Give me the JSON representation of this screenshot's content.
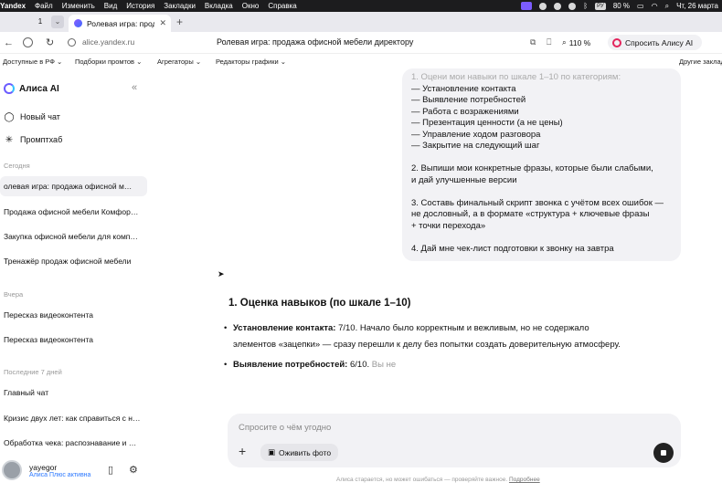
{
  "menubar": {
    "app": "Yandex",
    "items": [
      "Файл",
      "Изменить",
      "Вид",
      "История",
      "Закладки",
      "Вкладка",
      "Окно",
      "Справка"
    ],
    "battery": "80 %",
    "datetime": "Чт, 26 марта",
    "kbd": "РУ"
  },
  "tabs": {
    "count": "1",
    "active_title": "Ролевая игра: продаж"
  },
  "address": {
    "url": "alice.yandex.ru",
    "page_title": "Ролевая игра: продажа офисной мебели директору",
    "zoom": "110 %",
    "alice_button": "Спросить Алису AI"
  },
  "bookmarks": [
    "Доступные в РФ",
    "Подборки промтов",
    "Агрегаторы",
    "Редакторы графики",
    "Другие заклад"
  ],
  "sidebar": {
    "brand": "Алиса AI",
    "new_chat": "Новый чат",
    "prompthub": "Промптхаб",
    "sections": [
      {
        "heading": "Сегодня",
        "chats": [
          "олевая игра: продажа офисной м…",
          "Продажа офисной мебели Комфор…",
          "Закупка офисной мебели для комп…",
          "Тренажёр продаж офисной мебели"
        ]
      },
      {
        "heading": "Вчера",
        "chats": [
          "Пересказ видеоконтента",
          "Пересказ видеоконтента"
        ]
      },
      {
        "heading": "Последние 7 дней",
        "chats": [
          "Главный чат",
          "Кризис двух лет: как справиться с н…",
          "Обработка чека: распознавание и …"
        ]
      }
    ],
    "user": {
      "name": "yayegor",
      "plan": "Алиса Плюс активна"
    }
  },
  "prompt_bubble": {
    "lines": [
      "1. Оцени мои навыки по шкале 1–10 по категориям:",
      "— Установление контакта",
      "— Выявление потребностей",
      "— Работа с возражениями",
      "— Презентация ценности (а не цены)",
      "— Управление ходом разговора",
      "— Закрытие на следующий шаг",
      "",
      "2. Выпиши мои конкретные фразы, которые были слабыми,",
      "и дай улучшенные версии",
      "",
      "3. Составь финальный скрипт звонка с учётом всех ошибок —",
      "не дословный, а в формате «структура + ключевые фразы",
      "+ точки перехода»",
      "",
      "4. Дай мне чек-лист подготовки к звонку на завтра"
    ]
  },
  "answer": {
    "heading": "1. Оценка навыков (по шкале 1–10)",
    "b1_label": "Установление контакта:",
    "b1_text_1": " 7/10. Начало было корректным и вежливым, но не содержало",
    "b1_text_2": "элементов «зацепки» — сразу перешли к делу без попытки создать доверительную атмосферу.",
    "b2_label": "Выявление потребностей:",
    "b2_text": " 6/10.",
    "b2_fade": " Вы не"
  },
  "composer": {
    "placeholder": "Спросите о чём угодно",
    "photo_button": "Оживить фото",
    "disclaimer": "Алиса старается, но может ошибаться — проверяйте важное.",
    "disclaimer_link": "Подробнее"
  }
}
